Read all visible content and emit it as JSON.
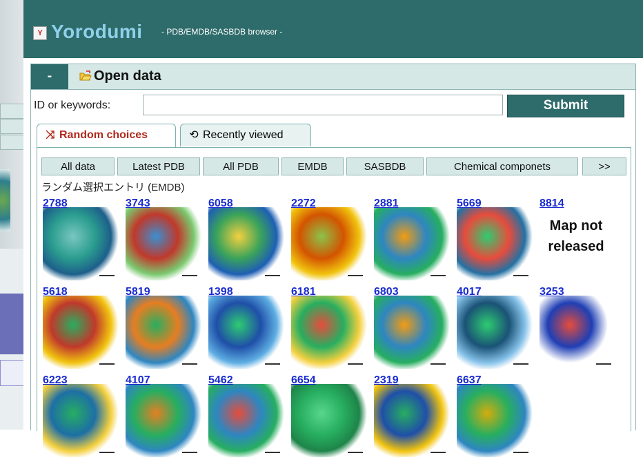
{
  "header": {
    "logo_text": "Y",
    "title": "Yorodumi",
    "subtitle": "- PDB/EMDB/SASBDB browser -"
  },
  "panel": {
    "collapse_label": "-",
    "title": "Open data"
  },
  "search": {
    "label": "ID or keywords:",
    "value": "",
    "submit_label": "Submit"
  },
  "tabs": [
    {
      "label": "Random choices",
      "icon": "shuffle-icon"
    },
    {
      "label": "Recently viewed",
      "icon": "history-icon"
    }
  ],
  "filters": [
    "All data",
    "Latest PDB",
    "All PDB",
    "EMDB",
    "SASBDB",
    "Chemical componets",
    ">>"
  ],
  "section_label": "ランダム選択エントリ (EMDB)",
  "entries": [
    {
      "id": "2788",
      "colors": [
        "#2a9d8f",
        "#7ac7c0",
        "#1d5f8a"
      ]
    },
    {
      "id": "3743",
      "colors": [
        "#c0392b",
        "#3a8fd1",
        "#7bc96f"
      ]
    },
    {
      "id": "6058",
      "colors": [
        "#3aa35a",
        "#f4d03f",
        "#1e5fb4"
      ]
    },
    {
      "id": "2272",
      "colors": [
        "#d35400",
        "#8bc34a",
        "#f1c40f"
      ]
    },
    {
      "id": "2881",
      "colors": [
        "#2e86c1",
        "#f39c12",
        "#27ae60"
      ]
    },
    {
      "id": "5669",
      "colors": [
        "#e74c3c",
        "#2ecc71",
        "#2471a3"
      ]
    },
    {
      "id": "8814",
      "message": "Map not released"
    },
    {
      "id": "5618",
      "colors": [
        "#c0392b",
        "#27ae60",
        "#f1c40f"
      ]
    },
    {
      "id": "5819",
      "colors": [
        "#e67e22",
        "#27ae60",
        "#2e86c1"
      ]
    },
    {
      "id": "1398",
      "colors": [
        "#1f4fa8",
        "#2ecc71",
        "#5dade2"
      ]
    },
    {
      "id": "6181",
      "colors": [
        "#27ae60",
        "#e74c3c",
        "#f4d03f"
      ]
    },
    {
      "id": "6803",
      "colors": [
        "#2e86c1",
        "#f39c12",
        "#27ae60"
      ]
    },
    {
      "id": "4017",
      "colors": [
        "#1a5276",
        "#2ecc71",
        "#85c1e9"
      ]
    },
    {
      "id": "3253",
      "colors": [
        "#1f3fb4",
        "#e74c3c",
        "#ffffff"
      ]
    },
    {
      "id": "6223",
      "colors": [
        "#1d6fa5",
        "#27ae60",
        "#f4d03f"
      ]
    },
    {
      "id": "4107",
      "colors": [
        "#27ae60",
        "#e67e22",
        "#2e86c1"
      ]
    },
    {
      "id": "5462",
      "colors": [
        "#2e86c1",
        "#e74c3c",
        "#27ae60"
      ]
    },
    {
      "id": "6654",
      "colors": [
        "#27ae60",
        "#58d68d",
        "#1e8449"
      ]
    },
    {
      "id": "2319",
      "colors": [
        "#1f4fa8",
        "#27ae60",
        "#f1c40f"
      ]
    },
    {
      "id": "6637",
      "colors": [
        "#27ae60",
        "#d4ac0d",
        "#2e86c1"
      ]
    }
  ],
  "colors": {
    "header_bg": "#2e6b6b",
    "title_color": "#8fd0ea",
    "link_color": "#1a2ccf",
    "active_tab_text": "#b02a1e",
    "panel_head_bg": "#d5e8e6"
  }
}
